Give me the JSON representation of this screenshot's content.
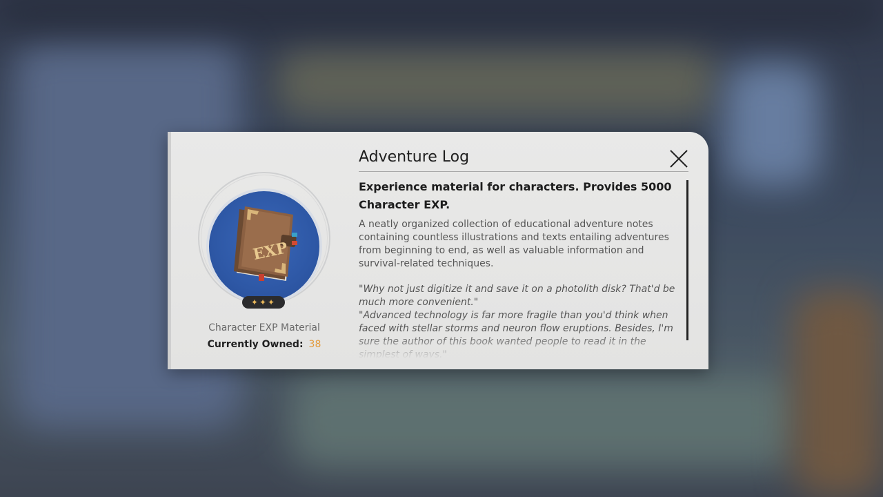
{
  "dialog": {
    "title": "Adventure Log",
    "summary": "Experience material for characters. Provides 5000 Character EXP.",
    "description": "A neatly organized collection of educational adventure notes containing countless illustrations and texts entailing adventures from beginning to end, as well as valuable information and survival-related techniques.",
    "quote": "\"Why not just digitize it and save it on a photolith disk? That'd be much more convenient.\"\n\"Advanced technology is far more fragile than you'd think when faced with stellar storms and neuron flow eruptions. Besides, I'm sure the author of this book wanted people to read it in the simplest of ways.\"",
    "close_icon": "close-icon"
  },
  "item": {
    "icon": "exp-book-icon",
    "book_label": "EXP",
    "rarity_stars": "✦✦✦",
    "rarity": 3,
    "type": "Character EXP Material",
    "owned_label": "Currently Owned:",
    "owned_value": "38"
  },
  "colors": {
    "panel": "#e6e6e5",
    "item_bg": "#2e58a6",
    "owned_value": "#e39a3a",
    "rarity_star": "#e8b75a"
  }
}
